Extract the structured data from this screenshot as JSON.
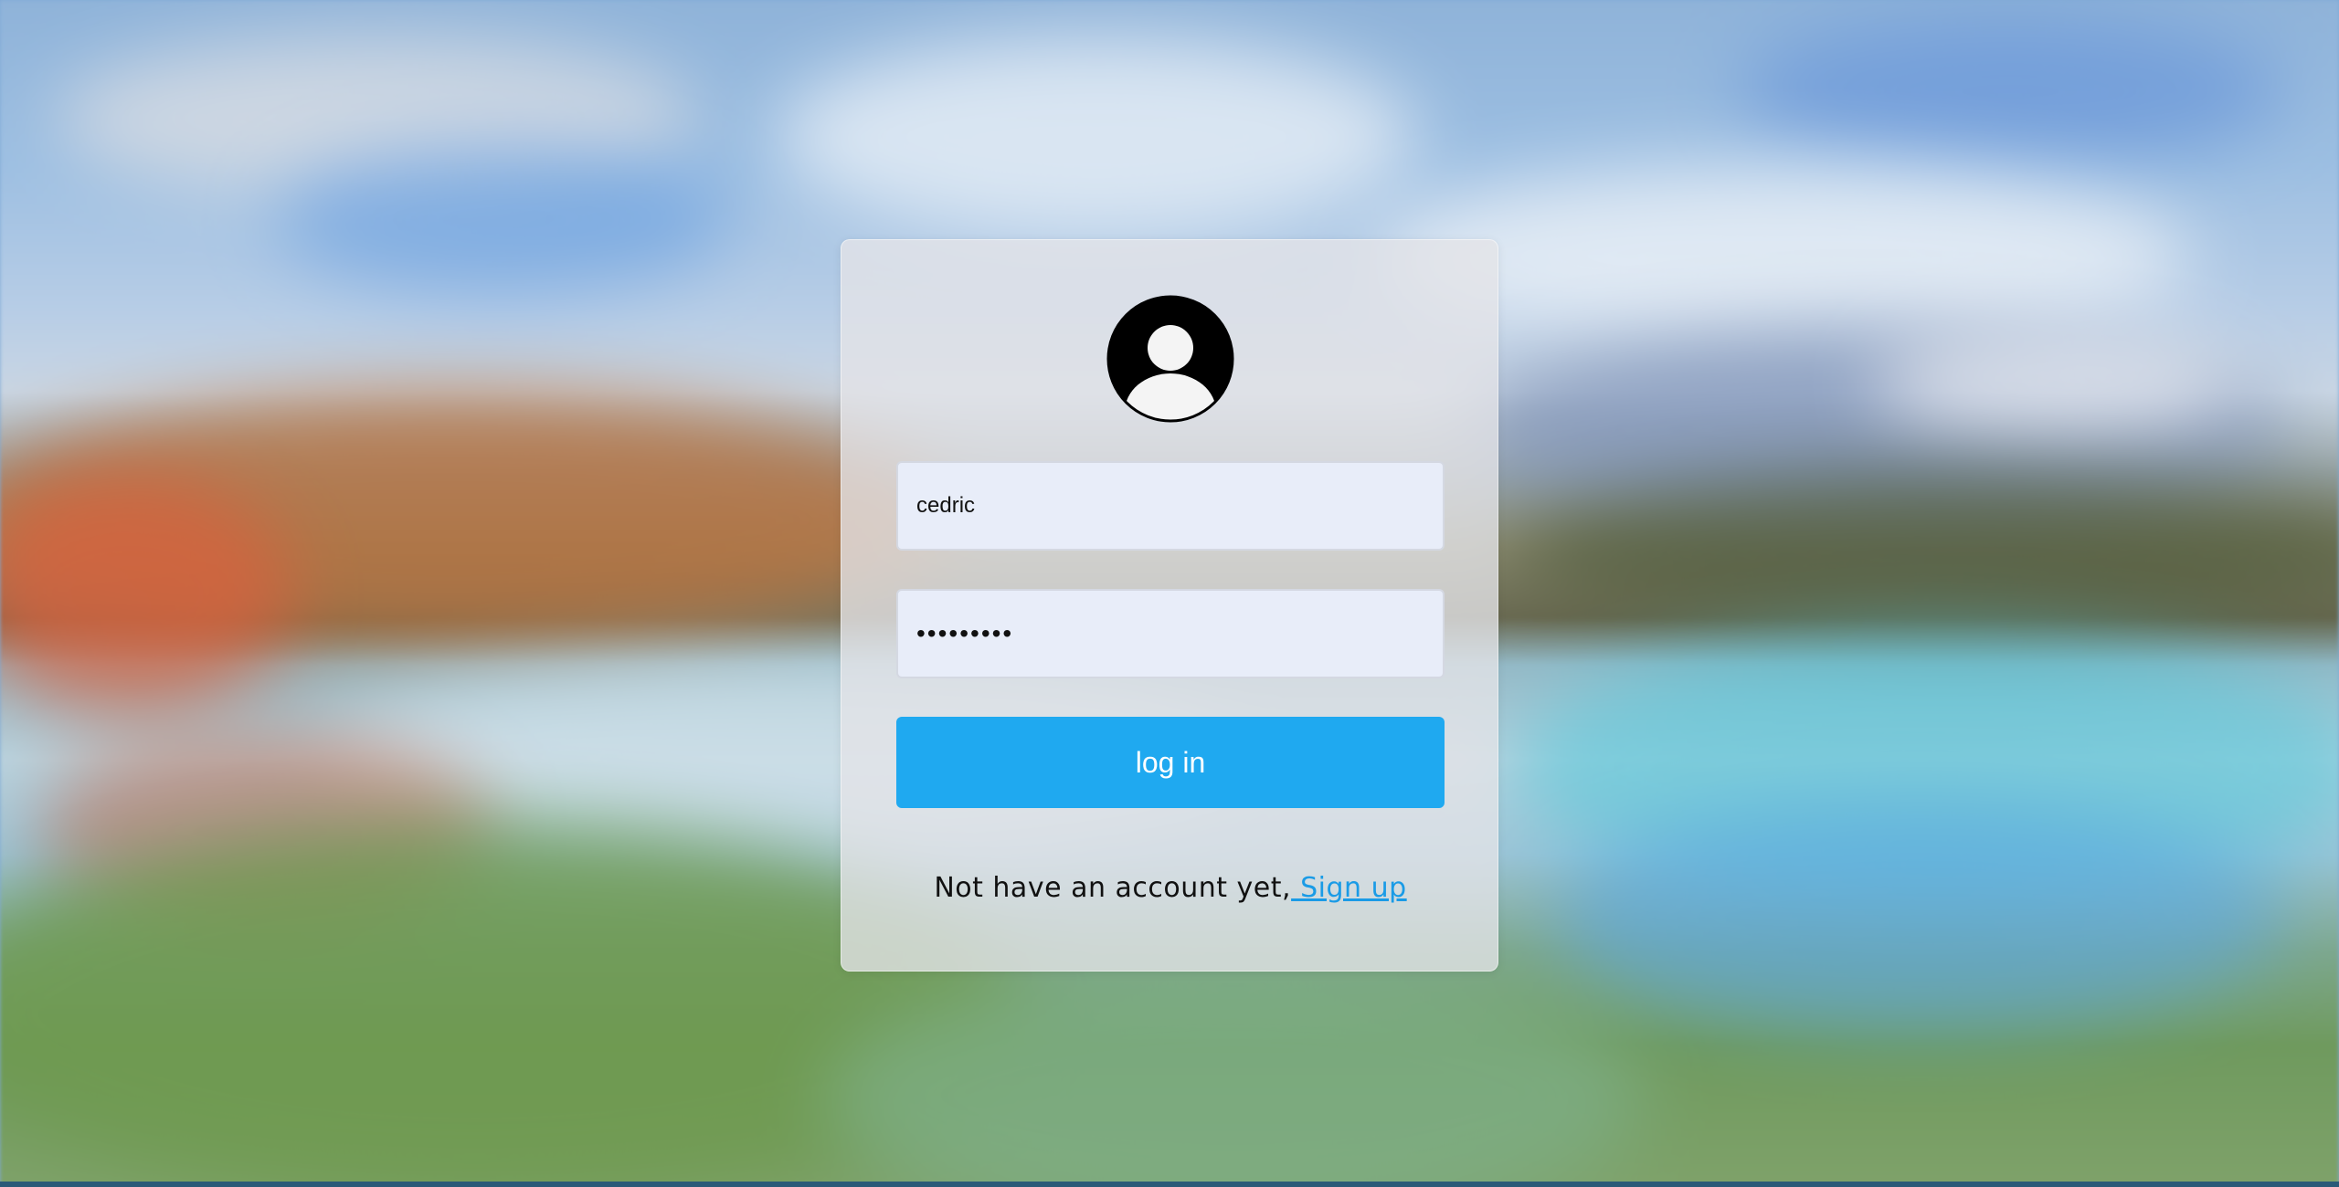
{
  "login": {
    "username_value": "cedric",
    "password_value": "•••••••••",
    "login_button": "log in",
    "signup_prompt": "Not have an account yet,",
    "signup_link": " Sign up"
  },
  "icons": {
    "avatar": "user-avatar-icon"
  },
  "colors": {
    "primary_button": "#1fa9f0",
    "link": "#1a9be6",
    "input_background": "#e8edf9"
  }
}
